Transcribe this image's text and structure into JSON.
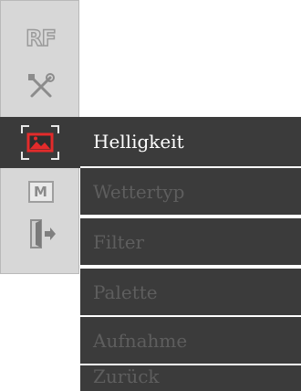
{
  "toolbar": {
    "rf_label": "RF",
    "mode_label": "M",
    "icons": [
      "rf-icon",
      "tools-icon",
      "image-icon",
      "mode-icon",
      "exit-icon"
    ]
  },
  "menu": {
    "items": [
      {
        "label": "Helligkeit",
        "selected": true
      },
      {
        "label": "Wettertyp",
        "selected": false
      },
      {
        "label": "Filter",
        "selected": false
      },
      {
        "label": "Palette",
        "selected": false
      },
      {
        "label": "Aufnahme",
        "selected": false
      },
      {
        "label": "Zurück",
        "selected": false
      }
    ]
  },
  "colors": {
    "toolbar_bg": "#d7d7d7",
    "menu_bg": "#3b3b3b",
    "selected_text": "#ffffff",
    "disabled_text": "#5e5e5e",
    "accent_red": "#e32b2b"
  }
}
